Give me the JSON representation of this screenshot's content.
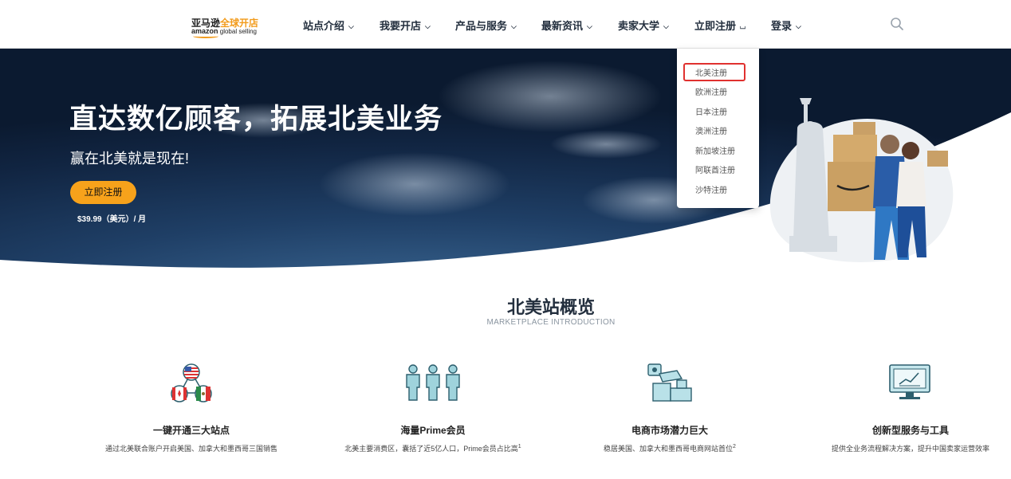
{
  "logo": {
    "zh_black": "亚马逊",
    "zh_orange": "全球开店",
    "en_brand": "amazon",
    "en_rest": "global selling"
  },
  "nav": [
    {
      "label": "站点介绍",
      "chevron": "down"
    },
    {
      "label": "我要开店",
      "chevron": "down"
    },
    {
      "label": "产品与服务",
      "chevron": "down"
    },
    {
      "label": "最新资讯",
      "chevron": "down"
    },
    {
      "label": "卖家大学",
      "chevron": "down"
    },
    {
      "label": "立即注册",
      "chevron": "up"
    },
    {
      "label": "登录",
      "chevron": "down"
    }
  ],
  "icons": {
    "search": "search-icon",
    "chevron_down": "˅",
    "chevron_up": "˄"
  },
  "dropdown": {
    "items": [
      "北美注册",
      "欧洲注册",
      "日本注册",
      "澳洲注册",
      "新加坡注册",
      "阿联酋注册",
      "沙特注册"
    ],
    "highlighted": "北美注册"
  },
  "hero": {
    "title": "直达数亿顾客，拓展北美业务",
    "subtitle": "赢在北美就是现在!",
    "cta": "立即注册",
    "price": "$39.99（美元）/ 月"
  },
  "overview": {
    "title": "北美站概览",
    "subtitle": "MARKETPLACE INTRODUCTION",
    "features": [
      {
        "icon": "flags-icon",
        "title": "一键开通三大站点",
        "desc": "通过北美联合账户开启美国、加拿大和墨西哥三国销售",
        "sup": ""
      },
      {
        "icon": "people-icon",
        "title": "海量Prime会员",
        "desc": "北美主要消费区，囊括了近5亿人口，Prime会员占比高",
        "sup": "1"
      },
      {
        "icon": "store-boxes-icon",
        "title": "电商市场潜力巨大",
        "desc": "稳居美国、加拿大和墨西哥电商网站首位",
        "sup": "2"
      },
      {
        "icon": "monitor-chart-icon",
        "title": "创新型服务与工具",
        "desc": "提供全业务流程解决方案，提升中国卖家运营效率",
        "sup": ""
      }
    ]
  },
  "colors": {
    "accent": "#f7a21b",
    "nav_text": "#232f3e",
    "highlight_border": "#e0312f",
    "icon_teal": "#2d5f6e"
  }
}
